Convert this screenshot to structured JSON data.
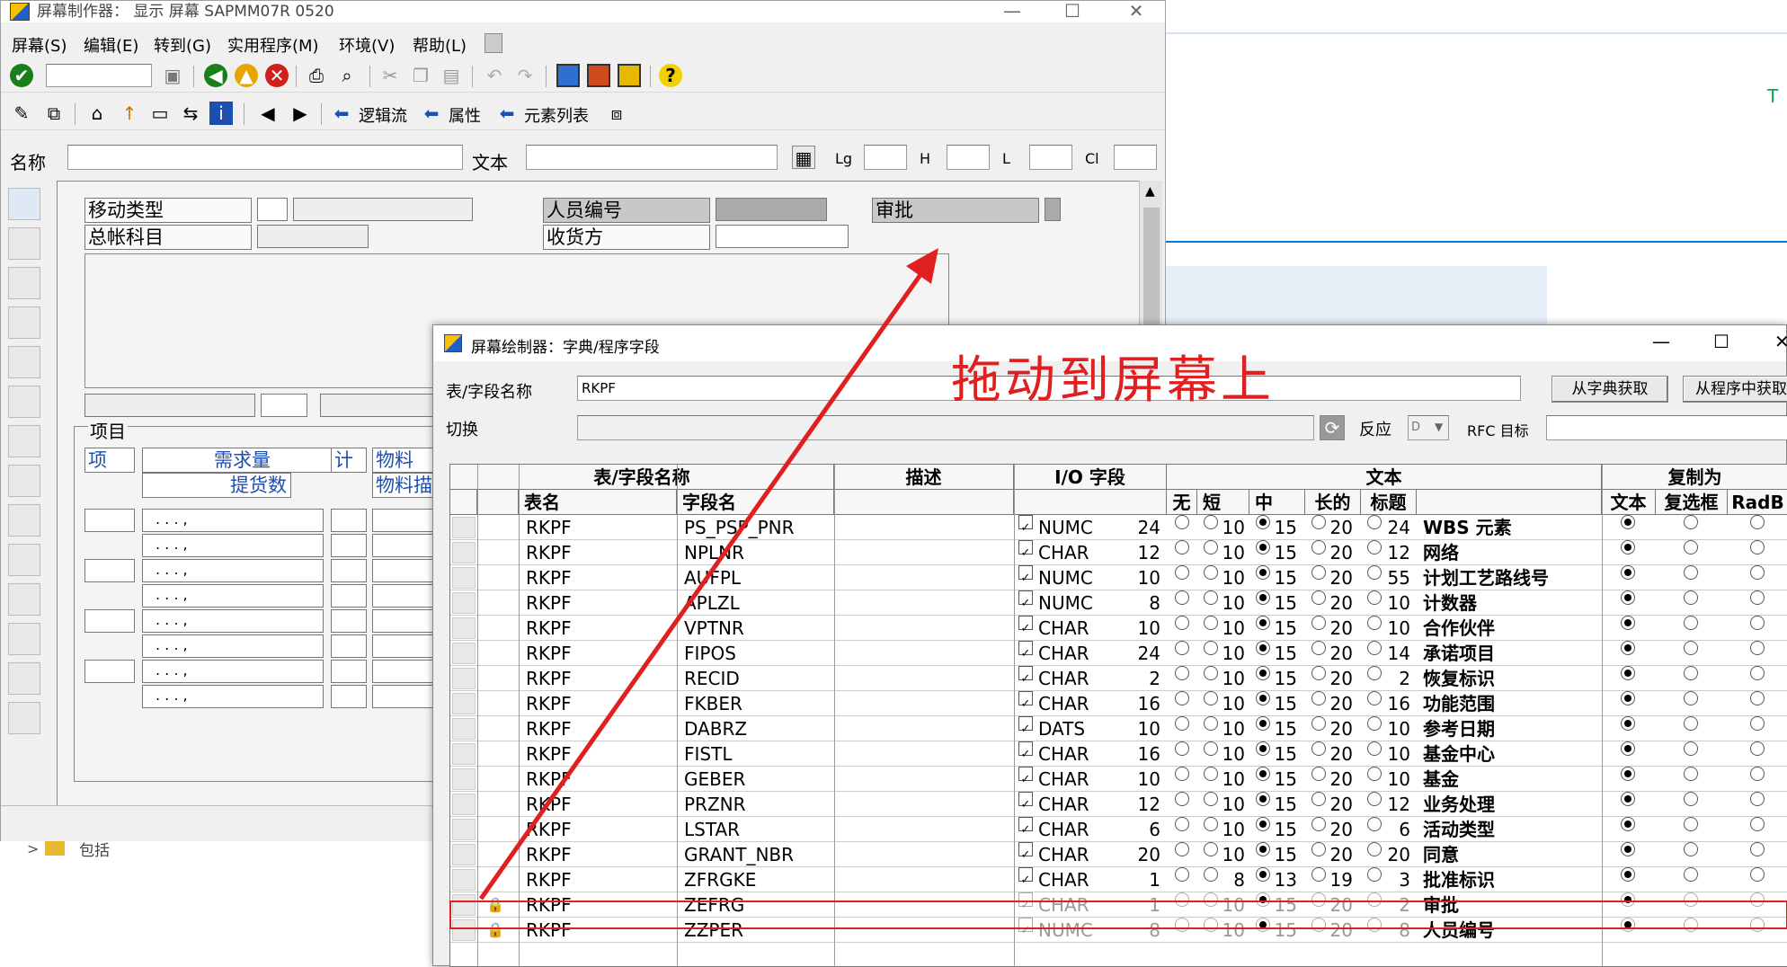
{
  "main_window": {
    "title": "屏幕制作器： 显示 屏幕 SAPMM07R 0520",
    "menu": [
      "屏幕(S)",
      "编辑(E)",
      "转到(G)",
      "实用程序(M)",
      "环境(V)",
      "帮助(L)"
    ],
    "toolbar2": {
      "logic_flow": "逻辑流",
      "attributes": "属性",
      "element_list": "元素列表"
    },
    "header": {
      "name_label": "名称",
      "text_label": "文本",
      "lg_label": "Lg",
      "h_label": "H",
      "l_label": "L",
      "cl_label": "Cl"
    },
    "canvas": {
      "movement_type": "移动类型",
      "gl_account": "总帐科目",
      "personnel_no": "人员编号",
      "approval": "审批",
      "recipient": "收货方",
      "items_title": "项目",
      "col_item": "项",
      "col_req_qty": "需求量",
      "col_count": "计",
      "col_material": "物料",
      "col_delivered": "提货数",
      "col_material_desc": "物料描",
      "dotted": ".    .    .    ,"
    },
    "folder_label": "包括"
  },
  "dialog": {
    "title": "屏幕绘制器：字典/程序字段",
    "table_field_label": "表/字段名称",
    "table_field_value": "RKPF",
    "switch_label": "切换",
    "response_label": "反应",
    "response_value": "D",
    "rfc_label": "RFC 目标",
    "btn_from_dict": "从字典获取",
    "btn_from_prog": "从程序中获取",
    "headers": {
      "table_field": "表/字段名称",
      "desc": "描述",
      "io": "I/O 字段",
      "text": "文本",
      "copy_as": "复制为",
      "table": "表名",
      "field": "字段名",
      "none": "无",
      "short": "短",
      "medium": "中",
      "long": "长的",
      "heading": "标题",
      "c_text": "文本",
      "c_check": "复选框",
      "c_radio": "RadB"
    },
    "rows": [
      {
        "t": "RKPF",
        "f": "PS_PSP_PNR",
        "type": "NUMC",
        "len": "24",
        "s": "10",
        "m": "15",
        "l": "20",
        "h": "24",
        "txt": "WBS 元素",
        "sel": "m"
      },
      {
        "t": "RKPF",
        "f": "NPLNR",
        "type": "CHAR",
        "len": "12",
        "s": "10",
        "m": "15",
        "l": "20",
        "h": "12",
        "txt": "网络",
        "sel": "m"
      },
      {
        "t": "RKPF",
        "f": "AUFPL",
        "type": "NUMC",
        "len": "10",
        "s": "10",
        "m": "15",
        "l": "20",
        "h": "55",
        "txt": "计划工艺路线号",
        "sel": "m"
      },
      {
        "t": "RKPF",
        "f": "APLZL",
        "type": "NUMC",
        "len": "8",
        "s": "10",
        "m": "15",
        "l": "20",
        "h": "10",
        "txt": "计数器",
        "sel": "m"
      },
      {
        "t": "RKPF",
        "f": "VPTNR",
        "type": "CHAR",
        "len": "10",
        "s": "10",
        "m": "15",
        "l": "20",
        "h": "10",
        "txt": "合作伙伴",
        "sel": "m"
      },
      {
        "t": "RKPF",
        "f": "FIPOS",
        "type": "CHAR",
        "len": "24",
        "s": "10",
        "m": "15",
        "l": "20",
        "h": "14",
        "txt": "承诺项目",
        "sel": "m"
      },
      {
        "t": "RKPF",
        "f": "RECID",
        "type": "CHAR",
        "len": "2",
        "s": "10",
        "m": "15",
        "l": "20",
        "h": "2",
        "txt": "恢复标识",
        "sel": "m"
      },
      {
        "t": "RKPF",
        "f": "FKBER",
        "type": "CHAR",
        "len": "16",
        "s": "10",
        "m": "15",
        "l": "20",
        "h": "16",
        "txt": "功能范围",
        "sel": "m"
      },
      {
        "t": "RKPF",
        "f": "DABRZ",
        "type": "DATS",
        "len": "10",
        "s": "10",
        "m": "15",
        "l": "20",
        "h": "10",
        "txt": "参考日期",
        "sel": "m"
      },
      {
        "t": "RKPF",
        "f": "FISTL",
        "type": "CHAR",
        "len": "16",
        "s": "10",
        "m": "15",
        "l": "20",
        "h": "10",
        "txt": "基金中心",
        "sel": "m"
      },
      {
        "t": "RKPF",
        "f": "GEBER",
        "type": "CHAR",
        "len": "10",
        "s": "10",
        "m": "15",
        "l": "20",
        "h": "10",
        "txt": "基金",
        "sel": "m"
      },
      {
        "t": "RKPF",
        "f": "PRZNR",
        "type": "CHAR",
        "len": "12",
        "s": "10",
        "m": "15",
        "l": "20",
        "h": "12",
        "txt": "业务处理",
        "sel": "m"
      },
      {
        "t": "RKPF",
        "f": "LSTAR",
        "type": "CHAR",
        "len": "6",
        "s": "10",
        "m": "15",
        "l": "20",
        "h": "6",
        "txt": "活动类型",
        "sel": "m"
      },
      {
        "t": "RKPF",
        "f": "GRANT_NBR",
        "type": "CHAR",
        "len": "20",
        "s": "10",
        "m": "15",
        "l": "20",
        "h": "20",
        "txt": "同意",
        "sel": "m"
      },
      {
        "t": "RKPF",
        "f": "ZFRGKE",
        "type": "CHAR",
        "len": "1",
        "s": "8",
        "m": "13",
        "l": "19",
        "h": "3",
        "txt": "批准标识",
        "sel": "m"
      },
      {
        "t": "RKPF",
        "f": "ZEFRG",
        "type": "CHAR",
        "len": "1",
        "s": "10",
        "m": "15",
        "l": "20",
        "h": "2",
        "txt": "审批",
        "sel": "m",
        "locked": true
      },
      {
        "t": "RKPF",
        "f": "ZZPER",
        "type": "NUMC",
        "len": "8",
        "s": "10",
        "m": "15",
        "l": "20",
        "h": "8",
        "txt": "人员编号",
        "sel": "m",
        "locked": true
      }
    ]
  },
  "annotation": "拖动到屏幕上",
  "colors": {
    "annotation": "#e02020",
    "window_bg": "#f0f0f0",
    "accent": "#0078d7"
  }
}
